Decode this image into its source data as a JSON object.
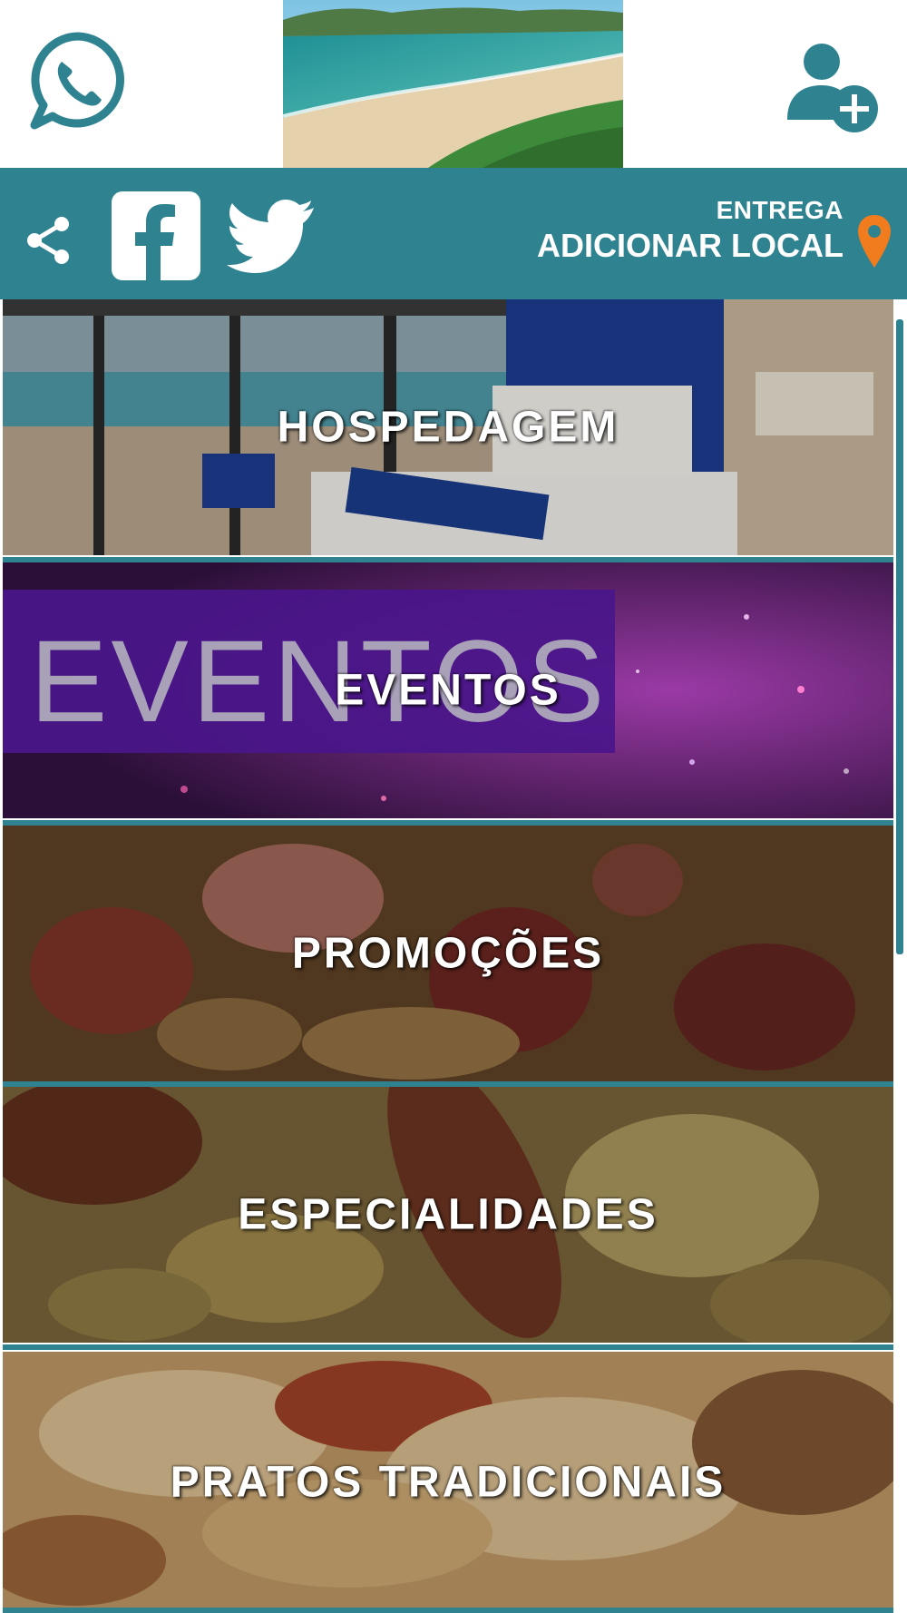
{
  "header": {
    "whatsapp_icon": "whatsapp-icon",
    "banner_alt": "",
    "add_user_icon": "add-user-icon"
  },
  "toolbar": {
    "share_icon": "share-icon",
    "facebook_icon": "facebook-icon",
    "twitter_icon": "twitter-icon",
    "delivery_label": "ENTREGA",
    "add_location_label": "ADICIONAR LOCAL",
    "pin_icon": "location-pin-icon"
  },
  "categories": [
    {
      "label": "HOSPEDAGEM"
    },
    {
      "label": "EVENTOS",
      "image_text": "EVENTOS"
    },
    {
      "label": "PROMOÇÕES"
    },
    {
      "label": "ESPECIALIDADES"
    },
    {
      "label": "PRATOS TRADICIONAIS"
    }
  ],
  "colors": {
    "brand": "#2f8391",
    "pin": "#f07c1e"
  }
}
